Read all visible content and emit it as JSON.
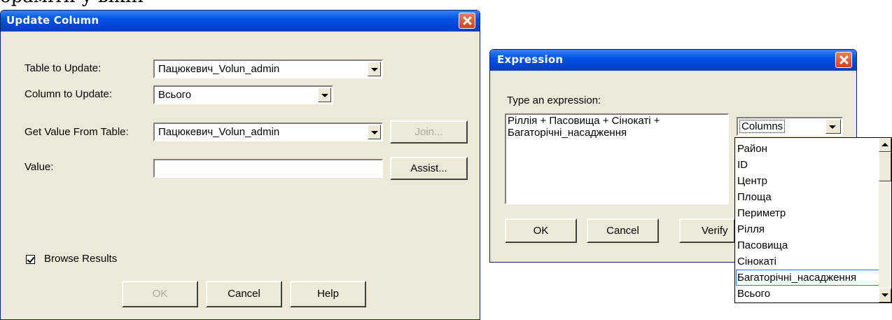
{
  "caption": "ораміти у вікні",
  "update_dialog": {
    "title": "Update Column",
    "table_label": "Table to Update:",
    "table_value": "Пацюкевич_Volun_admin",
    "column_label": "Column to Update:",
    "column_value": "Всього",
    "getfrom_label": "Get Value From Table:",
    "getfrom_value": "Пацюкевич_Volun_admin",
    "join_label": "Join...",
    "value_label": "Value:",
    "value_text": "",
    "assist_label": "Assist...",
    "browse_label": "Browse Results",
    "browse_checked": true,
    "ok_label": "OK",
    "cancel_label": "Cancel",
    "help_label": "Help"
  },
  "expression_dialog": {
    "title": "Expression",
    "prompt": "Type an expression:",
    "expression_line1": "Ріллія + Пасовища + Сінокаті +",
    "expression_line2": "Багаторічні_насадження",
    "columns_combo": "Columns",
    "ok_label": "OK",
    "cancel_label": "Cancel",
    "verify_label": "Verify",
    "columns_list": [
      "Район",
      "ID",
      "Центр",
      "Площа",
      "Периметр",
      "Рілля",
      "Пасовища",
      "Сінокаті",
      "Багаторічні_насадження",
      "Всього"
    ],
    "focused_item": "Багаторічні_насадження"
  },
  "colors": {
    "title_bar": "#0055e5",
    "dialog_face": "#ece9d8",
    "close_button": "#d34020",
    "focus_outline": "#3a6fd8"
  }
}
